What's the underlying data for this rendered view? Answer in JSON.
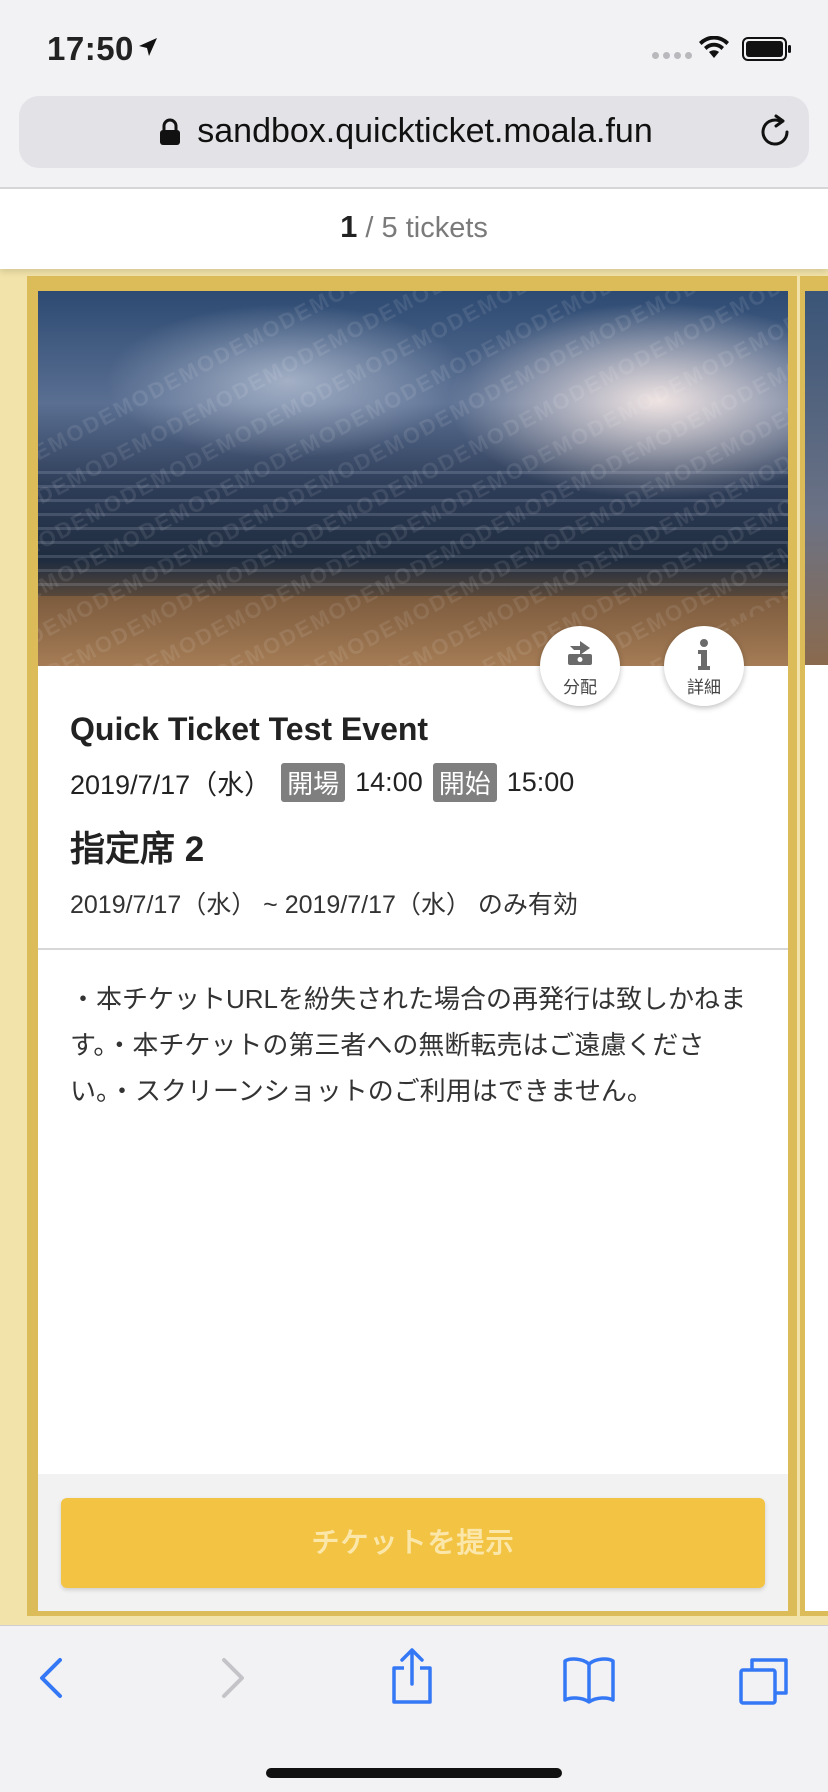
{
  "status_bar": {
    "time": "17:50"
  },
  "browser": {
    "url": "sandbox.quickticket.moala.fun"
  },
  "pager": {
    "current": "1",
    "rest": " / 5 tickets"
  },
  "ticket": {
    "hero_watermark": "DEMO",
    "distribute_label": "分配",
    "detail_label": "詳細",
    "event_title": "Quick Ticket Test Event",
    "event_date": "2019/7/17（水）",
    "open_tag": "開場",
    "open_time": "14:00",
    "start_tag": "開始",
    "start_time": "15:00",
    "seat_name": "指定席 2",
    "validity": "2019/7/17（水） ~ 2019/7/17（水） のみ有効",
    "notes": "・本チケットURLを紛失された場合の再発行は致しかねます。・本チケットの第三者への無断転売はご遠慮ください。・スクリーンショットのご利用はできません。",
    "present_button": "チケットを提示"
  },
  "colors": {
    "frame": "#dcbc58",
    "background": "#f1e3a9",
    "button": "#f3c343",
    "toolbar_icon": "#3478f6"
  }
}
